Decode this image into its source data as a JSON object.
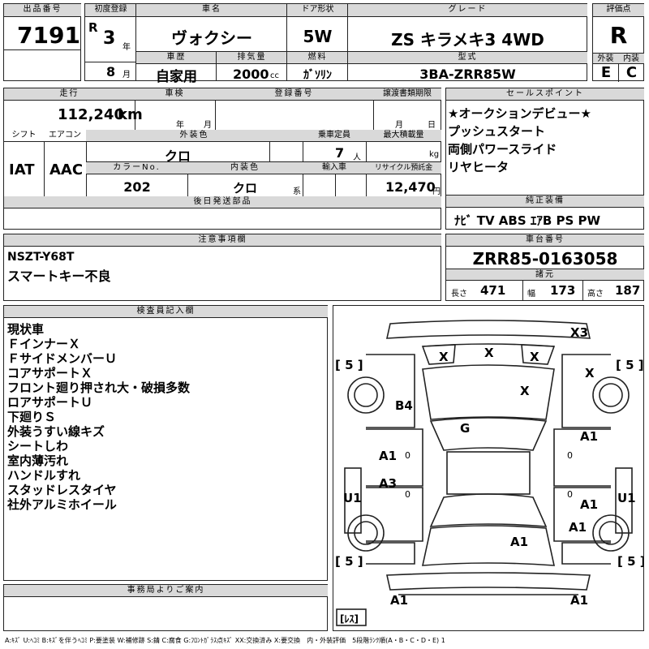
{
  "lot": {
    "label": "出品番号",
    "value": "7191"
  },
  "first_reg": {
    "label": "初度登録",
    "era": "R",
    "year": "3",
    "year_unit": "年",
    "month": "8",
    "month_unit": "月"
  },
  "car_name": {
    "label": "車名",
    "value": "ヴォクシー"
  },
  "door": {
    "label": "ドア形状",
    "value": "5W"
  },
  "grade": {
    "label": "グレード",
    "value": "ZS キラメキ3 4WD"
  },
  "score": {
    "label": "評価点",
    "value": "R",
    "ext_label": "外装",
    "int_label": "内装",
    "ext_value": "E",
    "int_value": "C"
  },
  "history": {
    "label": "車歴",
    "value": "自家用"
  },
  "displacement": {
    "label": "排気量",
    "value": "2000",
    "unit": "cc"
  },
  "fuel": {
    "label": "燃料",
    "value": "ｶﾞｿﾘﾝ"
  },
  "model": {
    "label": "型式",
    "value": "3BA-ZRR85W"
  },
  "mileage": {
    "label": "走行",
    "value": "112,240",
    "unit": "km"
  },
  "inspection": {
    "label": "車検",
    "year_unit": "年",
    "month_unit": "月"
  },
  "reg_no": {
    "label": "登録番号"
  },
  "transfer": {
    "label": "譲渡書類期限",
    "month_unit": "月",
    "day_unit": "日"
  },
  "shift": {
    "label": "シフト",
    "value": "IAT"
  },
  "ac": {
    "label": "エアコン",
    "value": "AAC"
  },
  "color": {
    "label": "外装色",
    "value": "クロ"
  },
  "capacity": {
    "label": "乗車定員",
    "value": "7",
    "unit": "人"
  },
  "load": {
    "label": "最大積載量",
    "unit": "kg"
  },
  "color_no": {
    "label": "カラーNo.",
    "value": "202"
  },
  "interior_color": {
    "label": "内装色",
    "value": "クロ",
    "unit": "系"
  },
  "import": {
    "label": "輸入車"
  },
  "recycle": {
    "label": "リサイクル預託金",
    "value": "12,470",
    "unit": "円"
  },
  "later_parts": {
    "label": "後日発送部品"
  },
  "sales_points": {
    "label": "セールスポイント",
    "items": [
      "★オークションデビュー★",
      "プッシュスタート",
      "両側パワースライド",
      "リヤヒータ"
    ]
  },
  "equipment": {
    "label": "純正装備",
    "value": "ﾅﾋﾞ TV ABS ｴｱB PS PW"
  },
  "notes": {
    "label": "注意事項欄",
    "lines": [
      "NSZT-Y68T",
      "スマートキー不良"
    ]
  },
  "chassis": {
    "label": "車台番号",
    "value": "ZRR85-0163058"
  },
  "dims": {
    "label": "諸元",
    "length_label": "長さ",
    "length": "471",
    "width_label": "幅",
    "width": "173",
    "height_label": "高さ",
    "height": "187"
  },
  "inspector": {
    "label": "検査員記入欄",
    "lines": [
      "現状車",
      "ＦインナーＸ",
      "ＦサイドメンバーＵ",
      "コアサポートＸ",
      "フロント廻り押され大・破損多数",
      "ロアサポートＵ",
      "下廻りＳ",
      "外装うすい線キズ",
      "シートしわ",
      "室内薄汚れ",
      "ハンドルすれ",
      "スタッドレスタイヤ",
      "社外アルミホイール"
    ]
  },
  "office": {
    "label": "事務局よりご案内"
  },
  "diagram": {
    "tires": {
      "fl": "[ 5 ]",
      "fr": "[ 5 ]",
      "rl": "[ 5 ]",
      "rr": "[ 5 ]",
      "spare": "[ﾚｽ]"
    },
    "marks": {
      "bumper_front": "X3",
      "grille_l": "X",
      "grille_c": "X",
      "grille_r": "X",
      "fender_r": "X",
      "hood": "X",
      "fender_l": "B4",
      "windshield": "G",
      "door_fl": "A1",
      "door_fr": "A1",
      "door_rl": "A3",
      "door_rr": "A1",
      "sill_l": "U1",
      "sill_r": "U1",
      "qtr_r": "A1",
      "roof": "A1",
      "rear_l": "A1",
      "rear_r": "A1",
      "zero_1": "0",
      "zero_2": "0",
      "zero_3": "0",
      "zero_4": "0"
    }
  },
  "legend": "A:ｷｽﾞ U:ﾍｺﾐ B:ｷｽﾞを伴うﾍｺﾐ P:要塗装 W:補修跡 S:錆 C:腐食 G:ﾌﾛﾝﾄｶﾞﾗｽ点ｷｽﾞ XX:交換済み X:要交換　内・外装評価　5段階ﾗﾝｸ順(A・B・C・D・E) 1"
}
